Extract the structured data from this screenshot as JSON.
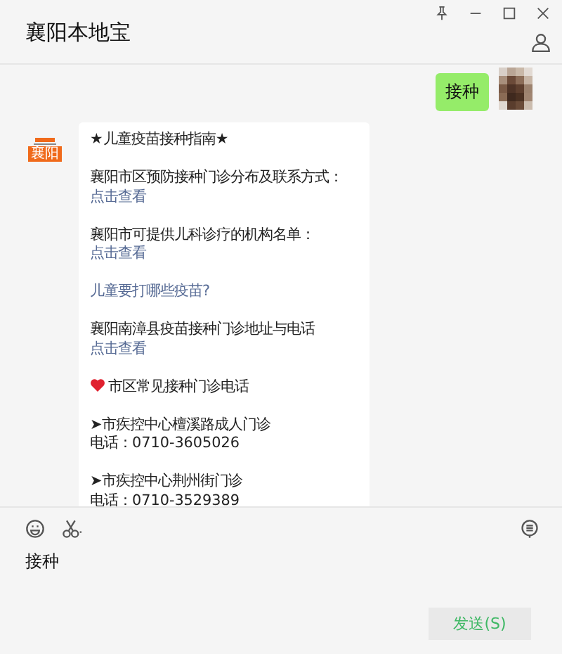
{
  "window": {
    "title": "襄阳本地宝"
  },
  "messages": [
    {
      "kind": "self",
      "text": "接种"
    },
    {
      "kind": "card",
      "badge": "襄阳",
      "blocks": [
        {
          "kind": "plain",
          "lines": [
            [
              {
                "text": "★儿童疫苗接种指南★",
                "link": false
              }
            ]
          ]
        },
        {
          "kind": "plain",
          "lines": [
            [
              {
                "text": "襄阳市区预防接种门诊分布及联系方式：",
                "link": false
              },
              {
                "text": "点击查看",
                "link": true
              }
            ]
          ]
        },
        {
          "kind": "plain",
          "lines": [
            [
              {
                "text": "襄阳市可提供儿科诊疗的机构名单：",
                "link": false
              }
            ],
            [
              {
                "text": "点击查看",
                "link": true
              }
            ]
          ]
        },
        {
          "kind": "plain",
          "lines": [
            [
              {
                "text": "儿童要打哪些疫苗?",
                "link": true
              }
            ]
          ]
        },
        {
          "kind": "plain",
          "lines": [
            [
              {
                "text": "襄阳南漳县疫苗接种门诊地址与电话",
                "link": false
              }
            ],
            [
              {
                "text": "点击查看",
                "link": true
              }
            ]
          ]
        },
        {
          "kind": "heart",
          "lines": [
            [
              {
                "text": "市区常见接种门诊电话",
                "link": false
              }
            ]
          ]
        },
        {
          "kind": "plain",
          "lines": [
            [
              {
                "text": "➤市疾控中心檀溪路成人门诊",
                "link": false
              }
            ],
            [
              {
                "text": "电话：0710-3605026",
                "link": false
              }
            ]
          ]
        },
        {
          "kind": "plain",
          "lines": [
            [
              {
                "text": "➤市疾控中心荆州街门诊",
                "link": false
              }
            ],
            [
              {
                "text": "电话：0710-3529389",
                "link": false
              }
            ]
          ]
        }
      ]
    }
  ],
  "composer": {
    "value": "接种"
  },
  "send_button": {
    "label": "发送(S)"
  }
}
